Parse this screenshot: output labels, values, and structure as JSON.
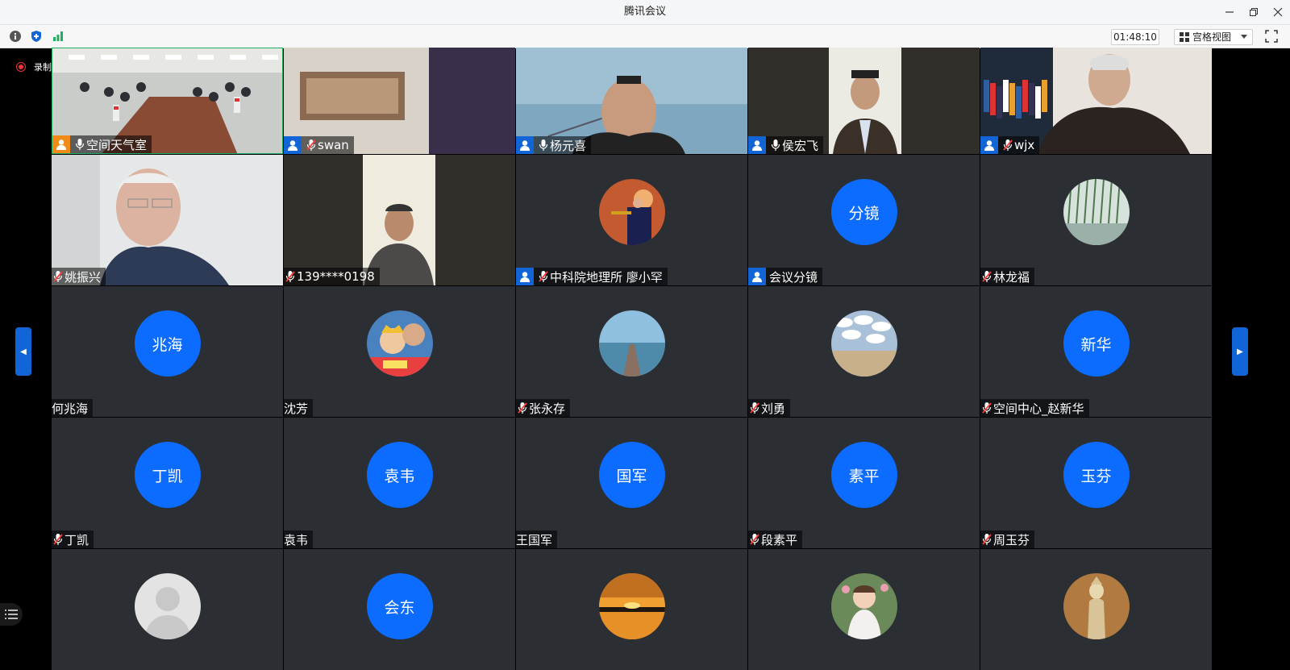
{
  "window": {
    "title": "腾讯会议"
  },
  "toolbar": {
    "timer": "01:48:10",
    "view_label": "宫格视图"
  },
  "recording": {
    "label": "录制中"
  },
  "colors": {
    "accent": "#0b6cff",
    "tile_bg": "#2b2e33",
    "active_border": "#1fae60",
    "rec_red": "#e33333"
  },
  "rows": [
    [
      {
        "name": "空间天气室",
        "kind": "video",
        "scene": "meeting-room",
        "host": "orange",
        "mic": "on",
        "active": true
      },
      {
        "name": "swan",
        "kind": "video",
        "scene": "blurry-room",
        "host": "blue",
        "mic": "off"
      },
      {
        "name": "杨元喜",
        "kind": "video",
        "scene": "man-seascape",
        "host": "blue",
        "mic": "on"
      },
      {
        "name": "侯宏飞",
        "kind": "video",
        "scene": "man-portrait",
        "host": "blue",
        "mic": "on"
      },
      {
        "name": "wjx",
        "kind": "video",
        "scene": "man-bookshelf",
        "host": "blue",
        "mic": "off"
      }
    ],
    [
      {
        "name": "姚振兴",
        "kind": "video",
        "scene": "elder-man",
        "mic": "off"
      },
      {
        "name": "139****0198",
        "kind": "video",
        "scene": "man-portrait-dark",
        "mic": "off"
      },
      {
        "name": "中科院地理所 廖小罕",
        "kind": "avatar",
        "avatar_icon": "trumpet-photo",
        "host": "blue",
        "mic": "off"
      },
      {
        "name": "会议分镜",
        "kind": "avatar",
        "avatar_text": "分镜",
        "host": "blue"
      },
      {
        "name": "林龙福",
        "kind": "avatar",
        "avatar_icon": "willow-photo",
        "mic": "off"
      }
    ],
    [
      {
        "name": "何兆海",
        "kind": "avatar",
        "avatar_text": "兆海"
      },
      {
        "name": "沈芳",
        "kind": "avatar",
        "avatar_icon": "family-photo"
      },
      {
        "name": "张永存",
        "kind": "avatar",
        "avatar_icon": "pier-photo",
        "mic": "off"
      },
      {
        "name": "刘勇",
        "kind": "avatar",
        "avatar_icon": "sky-field-photo",
        "mic": "off"
      },
      {
        "name": "空间中心_赵新华",
        "kind": "avatar",
        "avatar_text": "新华",
        "mic": "off"
      }
    ],
    [
      {
        "name": "丁凯",
        "kind": "avatar",
        "avatar_text": "丁凯",
        "mic": "off"
      },
      {
        "name": "袁韦",
        "kind": "avatar",
        "avatar_text": "袁韦"
      },
      {
        "name": "王国军",
        "kind": "avatar",
        "avatar_text": "国军"
      },
      {
        "name": "段素平",
        "kind": "avatar",
        "avatar_text": "素平",
        "mic": "off"
      },
      {
        "name": "周玉芬",
        "kind": "avatar",
        "avatar_text": "玉芬",
        "mic": "off"
      }
    ],
    [
      {
        "name": "",
        "kind": "avatar",
        "avatar_icon": "default-person"
      },
      {
        "name": "",
        "kind": "avatar",
        "avatar_text": "会东"
      },
      {
        "name": "",
        "kind": "avatar",
        "avatar_icon": "sunset-photo"
      },
      {
        "name": "",
        "kind": "avatar",
        "avatar_icon": "child-photo"
      },
      {
        "name": "",
        "kind": "avatar",
        "avatar_icon": "statue-photo"
      }
    ]
  ]
}
